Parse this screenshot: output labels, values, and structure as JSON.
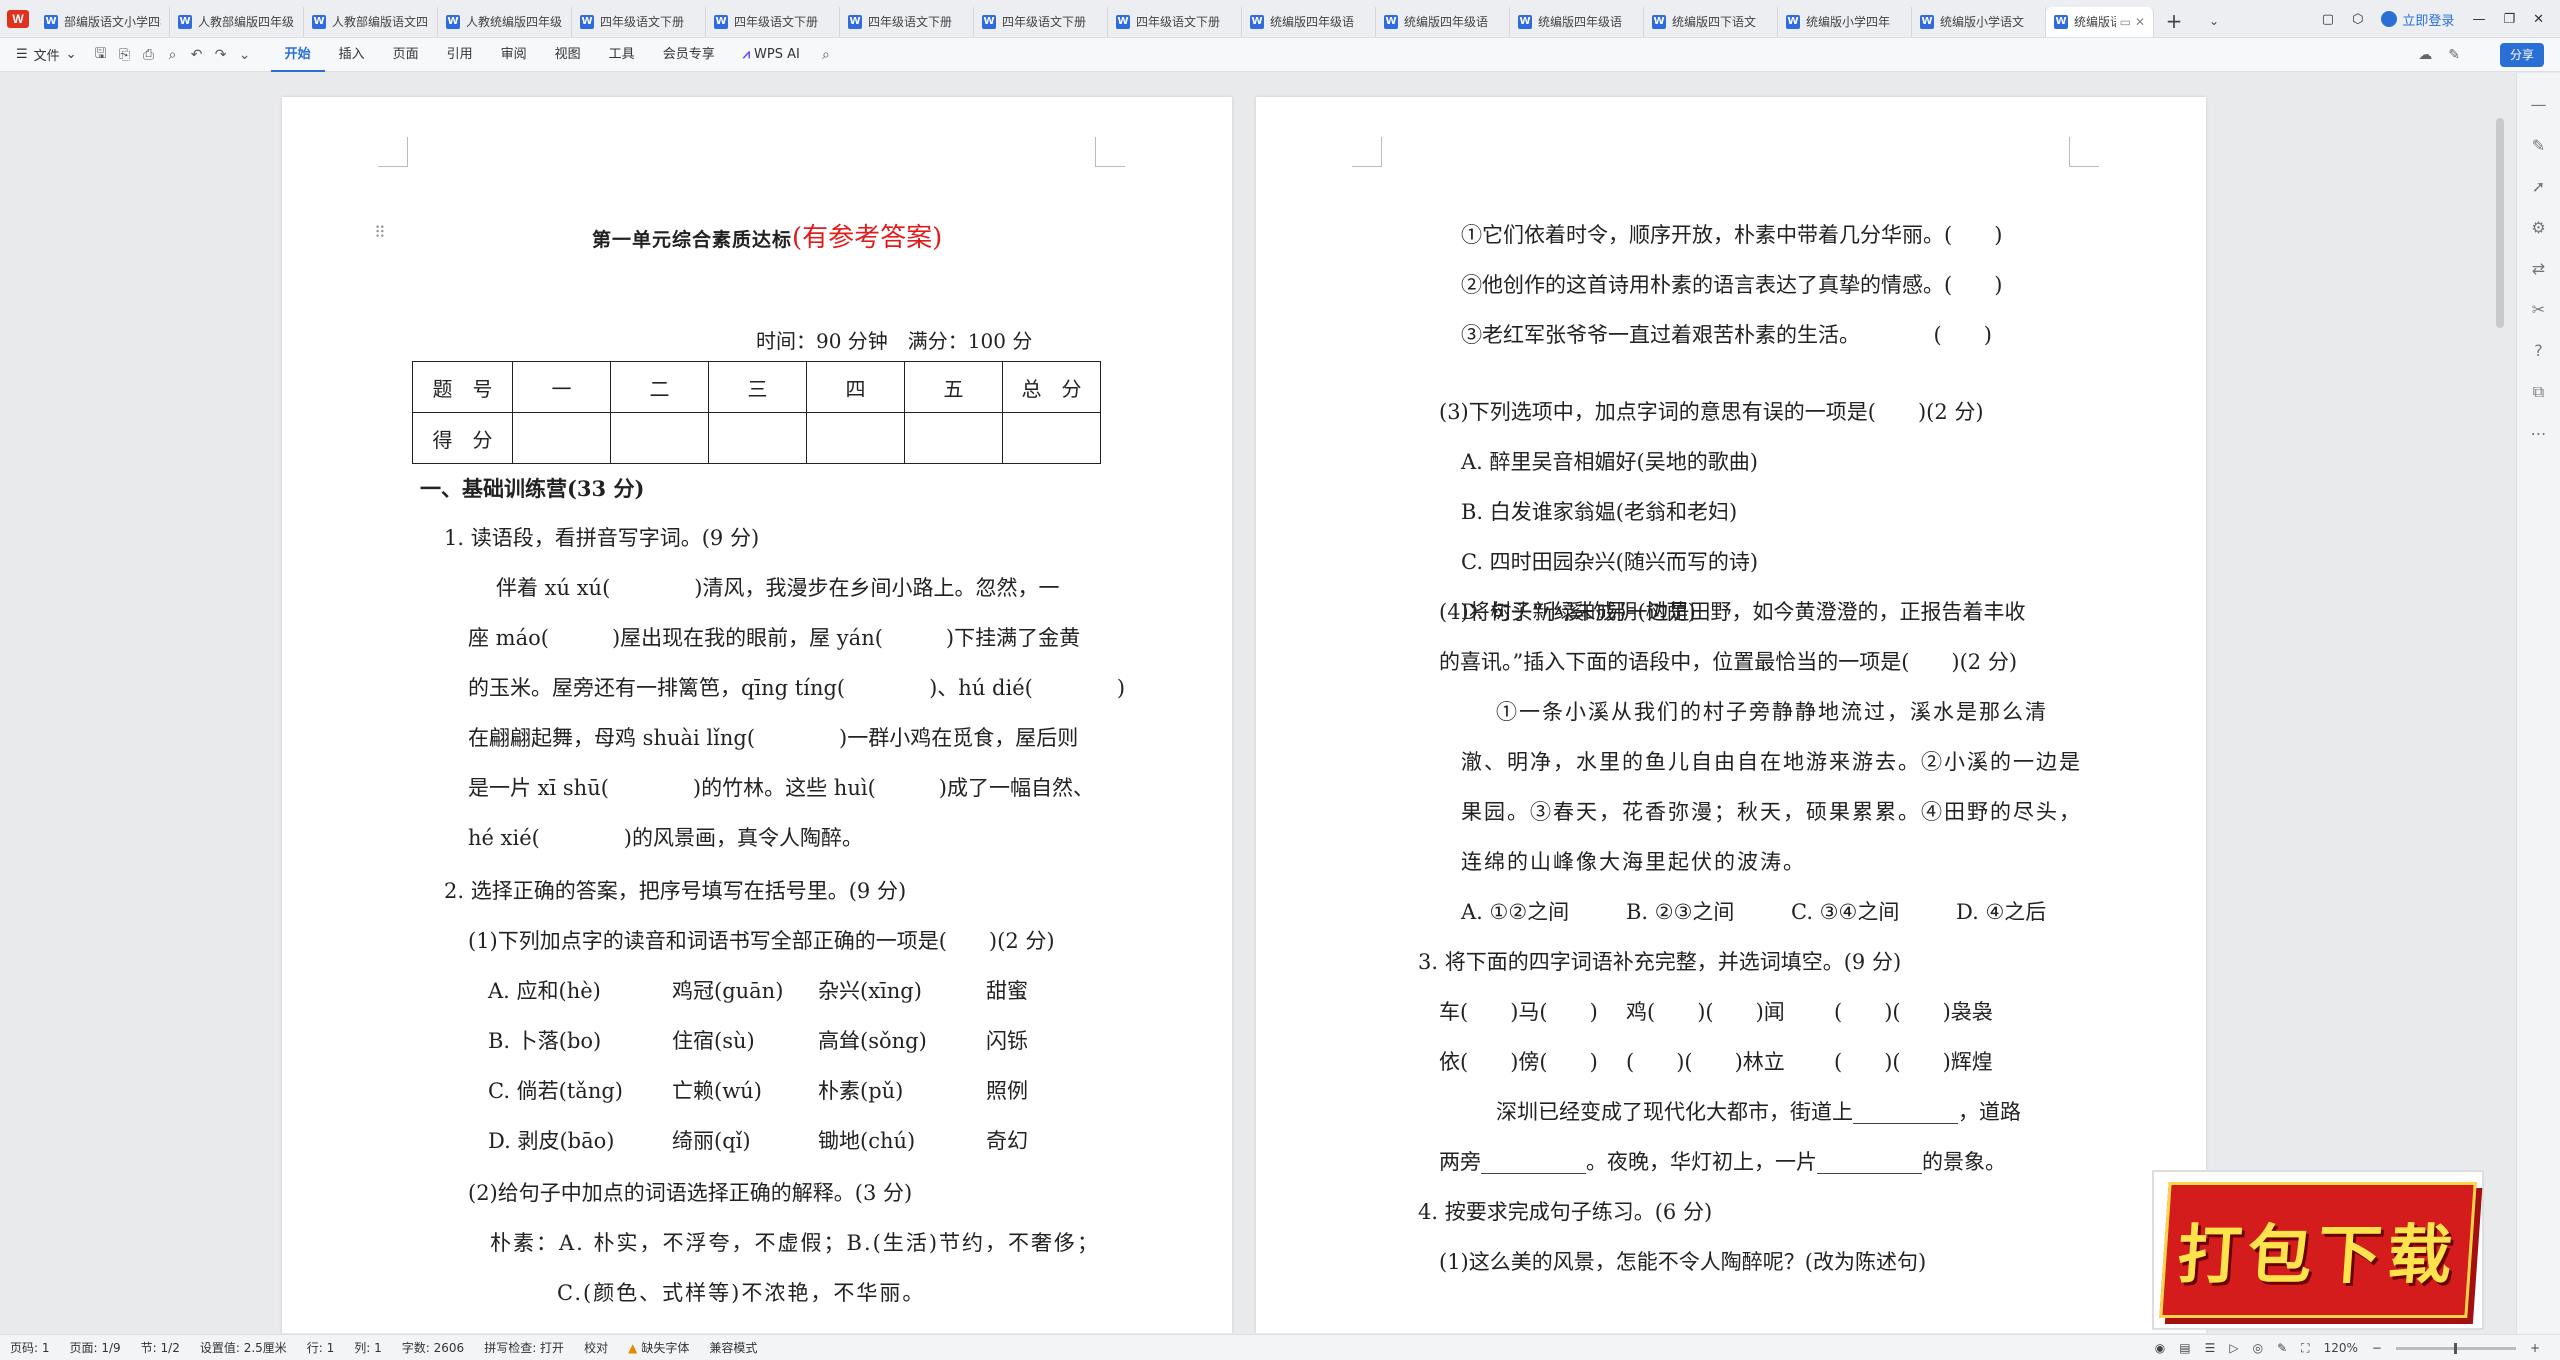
{
  "tabs": {
    "items": [
      {
        "label": "部编版语文小学四年"
      },
      {
        "label": "人教部编版四年级"
      },
      {
        "label": "人教部编版语文四"
      },
      {
        "label": "人教统编版四年级"
      },
      {
        "label": "四年级语文下册"
      },
      {
        "label": "四年级语文下册"
      },
      {
        "label": "四年级语文下册"
      },
      {
        "label": "四年级语文下册"
      },
      {
        "label": "四年级语文下册"
      },
      {
        "label": "统编版四年级语"
      },
      {
        "label": "统编版四年级语"
      },
      {
        "label": "统编版四年级语"
      },
      {
        "label": "统编版四下语文"
      },
      {
        "label": "统编版小学四年"
      },
      {
        "label": "统编版小学语文"
      }
    ],
    "active_label": "统编版语",
    "login": "立即登录"
  },
  "toolbar": {
    "file": "文件",
    "menus": [
      "开始",
      "插入",
      "页面",
      "引用",
      "审阅",
      "视图",
      "工具",
      "会员专享"
    ],
    "ai": "WPS AI",
    "share": "分享"
  },
  "page1": {
    "title": "第一单元综合素质达标",
    "title_red": "(有参考答案)",
    "time_line": "时间：90 分钟　满分：100 分",
    "score_table": {
      "headers": [
        "题　号",
        "一",
        "二",
        "三",
        "四",
        "五",
        "总　分"
      ],
      "row2": [
        "得　分",
        "",
        "",
        "",
        "",
        "",
        ""
      ]
    },
    "section1": "一、基础训练营(33 分)",
    "q1": "1. 读语段，看拼音写字词。(9 分)",
    "q1_lines": [
      "伴着 xú xú(　　　　)清风，我漫步在乡间小路上。忽然，一",
      "座 máo(　　　)屋出现在我的眼前，屋 yán(　　　)下挂满了金黄",
      "的玉米。屋旁还有一排篱笆，qīng tíng(　　　　)、hú dié(　　　　)",
      "在翩翩起舞，母鸡 shuài lǐng(　　　　)一群小鸡在觅食，屋后则",
      "是一片 xī shū(　　　　)的竹林。这些 huì(　　　)成了一幅自然、",
      "hé xié(　　　　)的风景画，真令人陶醉。"
    ],
    "q2": "2. 选择正确的答案，把序号填写在括号里。(9 分)",
    "q2_1": "(1)下列加点字的读音和词语书写全部正确的一项是(　　)(2 分)",
    "q2_1_options": [
      [
        "A. 应和(hè)",
        "鸡冠(guān)",
        "杂兴(xīng)",
        "甜蜜"
      ],
      [
        "B. 卜落(bo)",
        "住宿(sù)",
        "高耸(sǒng)",
        "闪铄"
      ],
      [
        "C. 倘若(tǎng)",
        "亡赖(wú)",
        "朴素(pǔ)",
        "照例"
      ],
      [
        "D. 剥皮(bāo)",
        "绮丽(qǐ)",
        "锄地(chú)",
        "奇幻"
      ]
    ],
    "q2_2": "(2)给句子中加点的词语选择正确的解释。(3 分)",
    "q2_2_def1": "朴素：A. 朴实，不浮夸，不虚假；B.(生活)节约，不奢侈；",
    "q2_2_def2": "C.(颜色、式样等)不浓艳，不华丽。"
  },
  "page2": {
    "lines_top": [
      "①它们依着时令，顺序开放，朴素中带着几分华丽。(　　)",
      "②他创作的这首诗用朴素的语言表达了真挚的情感。(　　)",
      "③老红军张爷爷一直过着艰苦朴素的生活。　　　　(　　)"
    ],
    "q3": "(3)下列选项中，加点字词的意思有误的一项是(　　)(2 分)",
    "q3_options": [
      "A. 醉里吴音相媚好(吴地的歌曲)",
      "B. 白发谁家翁媪(老翁和老妇)",
      "C. 四时田园杂兴(随兴而写的诗)",
      "D. 树头新绿未成阴(树荫)"
    ],
    "q4_line1": "(4)将句子“小溪的另一边是田野，如今黄澄澄的，正报告着丰收",
    "q4_line2": "的喜讯。”插入下面的语段中，位置最恰当的一项是(　　)(2 分)",
    "q4_passage": [
      "①一条小溪从我们的村子旁静静地流过，溪水是那么清",
      "澈、明净，水里的鱼儿自由自在地游来游去。②小溪的一边是",
      "果园。③春天，花香弥漫；秋天，硕果累累。④田野的尽头，",
      "连绵的山峰像大海里起伏的波涛。"
    ],
    "q4_options": [
      "A. ①②之间",
      "B. ②③之间",
      "C. ③④之间",
      "D. ④之后"
    ],
    "q3_main": "3. 将下面的四字词语补充完整，并选词填空。(9 分)",
    "idioms_row1": [
      "车(　　)马(　　)",
      "鸡(　　)(　　)闻",
      "(　　)(　　)袅袅"
    ],
    "idioms_row2": [
      "依(　　)傍(　　)",
      "(　　)(　　)林立",
      "(　　)(　　)辉煌"
    ],
    "fill1": "深圳已经变成了现代化大都市，街道上__________，道路",
    "fill2": "两旁__________。夜晚，华灯初上，一片__________的景象。",
    "q4_main": "4. 按要求完成句子练习。(6 分)",
    "q4_1": "(1)这么美的风景，怎能不令人陶醉呢？(改为陈述句)"
  },
  "status": {
    "page_num": "页码: 1",
    "pages": "页面: 1/9",
    "section": "节: 1/2",
    "setting": "设置值: 2.5厘米",
    "row": "行: 1",
    "col": "列: 1",
    "words": "字数: 2606",
    "spell": "拼写检查: 打开",
    "proof": "校对",
    "missing_font": "缺失字体",
    "compat": "兼容模式",
    "zoom": "120%"
  },
  "banner": {
    "text": "打包下载"
  }
}
